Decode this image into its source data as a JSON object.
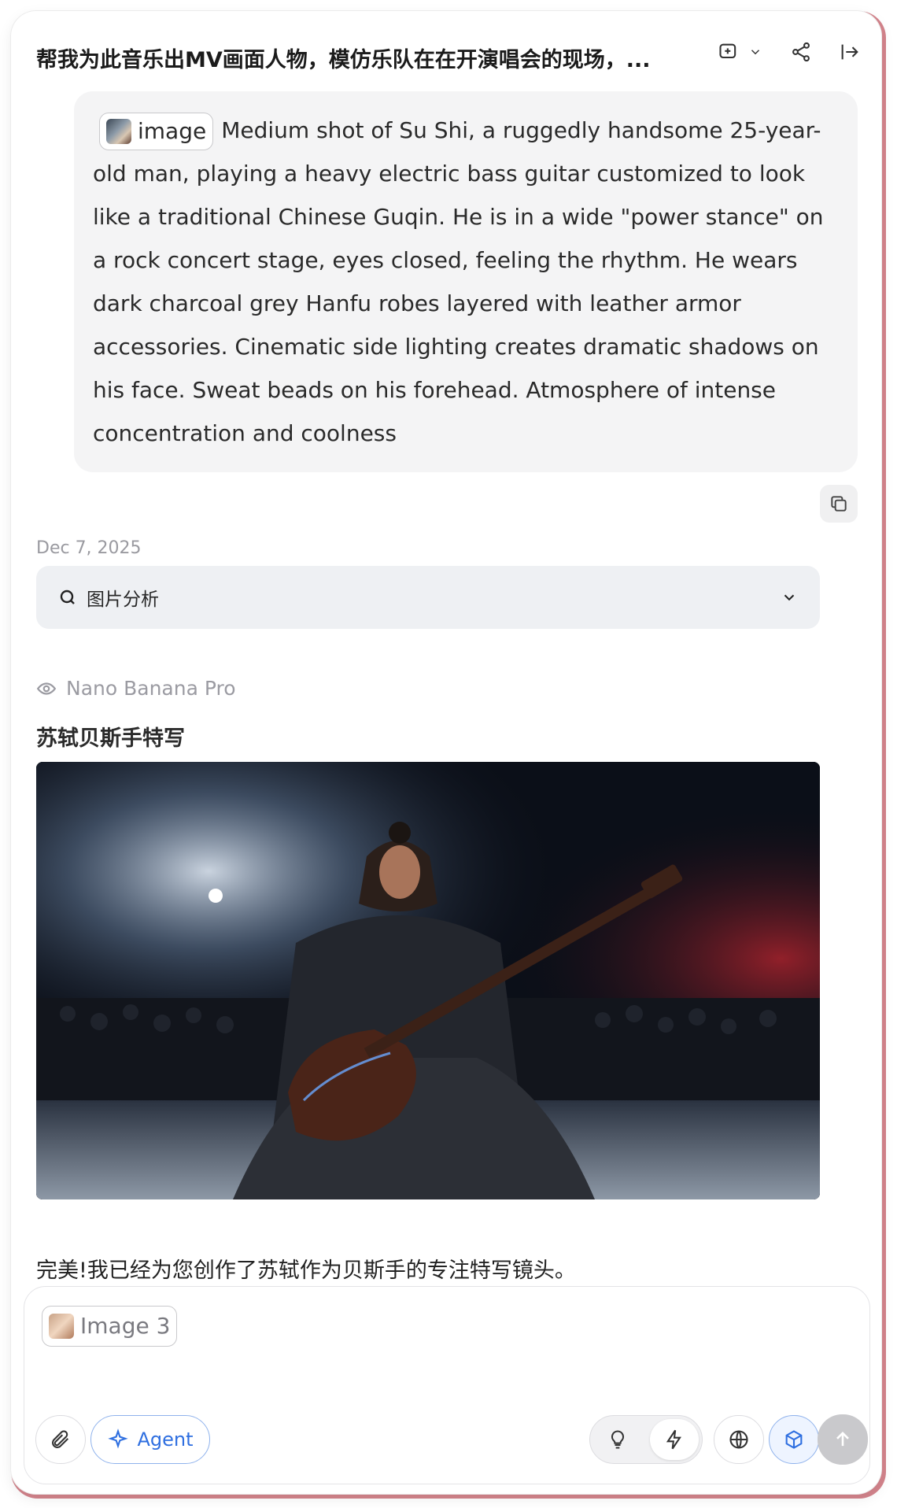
{
  "header": {
    "title": "帮我为此音乐出MV画面人物，模仿乐队在在开演唱会的现场，..."
  },
  "prompt": {
    "chip_label": "image",
    "text": "Medium shot of Su Shi, a ruggedly handsome 25-year-old man, playing a heavy electric bass guitar customized to look like a traditional Chinese Guqin. He is in a wide \"power stance\" on a rock concert stage, eyes closed, feeling the rhythm. He wears dark charcoal grey Hanfu robes layered with leather armor accessories. Cinematic side lighting creates dramatic shadows on his face. Sweat beads on his forehead. Atmosphere of intense concentration and coolness"
  },
  "date": "Dec 7, 2025",
  "analysis": {
    "label": "图片分析"
  },
  "response": {
    "model": "Nano Banana Pro",
    "title": "苏轼贝斯手特写",
    "message": "完美!我已经为您创作了苏轼作为贝斯手的专注特写镜头。"
  },
  "composer": {
    "attachment_label": "Image 3",
    "agent_label": "Agent"
  },
  "colors": {
    "accent": "#2f6fe0",
    "frame": "#d4848c",
    "bubble": "#f4f4f5"
  }
}
